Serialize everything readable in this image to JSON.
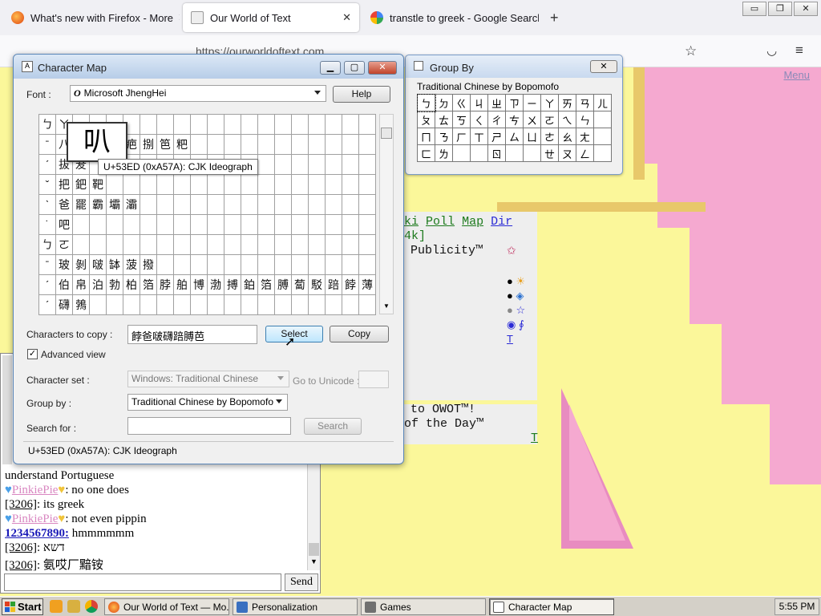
{
  "browser": {
    "tabs": [
      {
        "label": "What's new with Firefox - More",
        "active": false
      },
      {
        "label": "Our World of Text",
        "active": true
      },
      {
        "label": "transtle to greek - Google Search",
        "active": false
      }
    ],
    "new_tab": "+",
    "url": "https://ourworldoftext.com",
    "window_controls": [
      "▭",
      "❐",
      "✕"
    ]
  },
  "page": {
    "menu_link": "Menu",
    "nav_links": [
      "ki",
      "Poll",
      "Map",
      "Dir"
    ],
    "bracket_text": "4k]",
    "publicity": "Publicity™",
    "welcome": "to OWOT™!",
    "day": "of the Day™",
    "t_link": "T",
    "t_link2": "T",
    "symbols": [
      "●",
      "☀",
      "●",
      "◈",
      "●",
      "☆",
      "◉",
      "∮"
    ]
  },
  "chat": {
    "messages": [
      {
        "user": "",
        "text": "understand Portuguese"
      },
      {
        "user": "PinkiePie",
        "text": " no one does",
        "style": "pinkie"
      },
      {
        "user": "[3206]",
        "text": " its greek",
        "style": "anon"
      },
      {
        "user": "PinkiePie",
        "text": " not even pippin",
        "style": "pinkie"
      },
      {
        "user": "1234567890:",
        "text": " hmmmmmm",
        "style": "registered"
      },
      {
        "user": "[3206]",
        "text": " דשא",
        "style": "anon"
      },
      {
        "user": "[3206]",
        "text": " 氨哎厂黯铵",
        "style": "anon"
      }
    ],
    "send_label": "Send"
  },
  "group_by": {
    "title": "Group By",
    "close": "✕",
    "label": "Traditional Chinese by Bopomofo",
    "rows": [
      [
        "ㄅ",
        "ㄉ",
        "ㄍ",
        "ㄐ",
        "ㄓ",
        "ㄗ",
        "ㄧ",
        "ㄚ",
        "ㄞ",
        "ㄢ",
        "ㄦ"
      ],
      [
        "ㄆ",
        "ㄊ",
        "ㄎ",
        "ㄑ",
        "ㄔ",
        "ㄘ",
        "ㄨ",
        "ㄛ",
        "ㄟ",
        "ㄣ",
        ""
      ],
      [
        "ㄇ",
        "ㄋ",
        "ㄏ",
        "ㄒ",
        "ㄕ",
        "ㄙ",
        "ㄩ",
        "ㄜ",
        "ㄠ",
        "ㄤ",
        ""
      ],
      [
        "ㄈ",
        "ㄌ",
        "",
        "",
        "ㄖ",
        "",
        "",
        "ㄝ",
        "ㄡ",
        "ㄥ",
        ""
      ]
    ]
  },
  "charmap": {
    "title": "Character Map",
    "font_label": "Font :",
    "font_value": "Microsoft JhengHei",
    "help_label": "Help",
    "grid": [
      [
        "ㄅ",
        "ㄚ",
        "",
        "",
        "",
        "",
        "",
        "",
        "",
        "",
        "",
        "",
        "",
        "",
        "",
        "",
        "",
        "",
        "",
        ""
      ],
      [
        "ˉ",
        "八",
        "",
        "",
        "芭",
        "疤",
        "捌",
        "笆",
        "粑",
        "",
        "",
        "",
        "",
        "",
        "",
        "",
        "",
        "",
        "",
        ""
      ],
      [
        "ˊ",
        "拔",
        "茇",
        "",
        "",
        "",
        "",
        "",
        "",
        "",
        "",
        "",
        "",
        "",
        "",
        "",
        "",
        "",
        "",
        ""
      ],
      [
        "ˇ",
        "把",
        "鈀",
        "靶",
        "",
        "",
        "",
        "",
        "",
        "",
        "",
        "",
        "",
        "",
        "",
        "",
        "",
        "",
        "",
        ""
      ],
      [
        "ˋ",
        "爸",
        "罷",
        "霸",
        "壩",
        "灞",
        "",
        "",
        "",
        "",
        "",
        "",
        "",
        "",
        "",
        "",
        "",
        "",
        "",
        ""
      ],
      [
        "˙",
        "吧",
        "",
        "",
        "",
        "",
        "",
        "",
        "",
        "",
        "",
        "",
        "",
        "",
        "",
        "",
        "",
        "",
        "",
        ""
      ],
      [
        "ㄅ",
        "ㄛ",
        "",
        "",
        "",
        "",
        "",
        "",
        "",
        "",
        "",
        "",
        "",
        "",
        "",
        "",
        "",
        "",
        "",
        ""
      ],
      [
        "ˉ",
        "玻",
        "剝",
        "啵",
        "缽",
        "菠",
        "撥",
        "",
        "",
        "",
        "",
        "",
        "",
        "",
        "",
        "",
        "",
        "",
        "",
        ""
      ],
      [
        "ˊ",
        "伯",
        "帛",
        "泊",
        "勃",
        "柏",
        "箔",
        "脖",
        "舶",
        "博",
        "渤",
        "搏",
        "鉑",
        "箔",
        "膊",
        "蔔",
        "駁",
        "踣",
        "餑",
        "薄"
      ],
      [
        "ˊ",
        "礴",
        "鵓",
        "",
        "",
        "",
        "",
        "",
        "",
        "",
        "",
        "",
        "",
        "",
        "",
        "",
        "",
        "",
        "",
        ""
      ]
    ],
    "zoom_char": "叭",
    "tooltip": "U+53ED (0xA57A): CJK Ideograph",
    "copy_label": "Characters to copy :",
    "copy_value": "餑爸啵礴踣膊芭",
    "select_label": "Select",
    "copy_button": "Copy",
    "advanced_label": "Advanced view",
    "advanced_checked": true,
    "charset_label": "Character set :",
    "charset_value": "Windows: Traditional Chinese",
    "goto_label": "Go to Unicode :",
    "groupby_label": "Group by :",
    "groupby_value": "Traditional Chinese by Bopomofo",
    "search_label": "Search for :",
    "search_button": "Search",
    "status": "U+53ED (0xA57A): CJK Ideograph"
  },
  "taskbar": {
    "start": "Start",
    "tasks": [
      {
        "label": "Our World of Text — Mo...",
        "active": false
      },
      {
        "label": "Personalization",
        "active": false
      },
      {
        "label": "Games",
        "active": false
      },
      {
        "label": "Character Map",
        "active": true
      }
    ],
    "time": "5:55 PM"
  },
  "colors": {
    "canvas_yellow": "#fbf79a",
    "canvas_pink": "#f5a9d0",
    "link_green": "#1d7a1d",
    "accent_blue": "#5a86b8"
  }
}
